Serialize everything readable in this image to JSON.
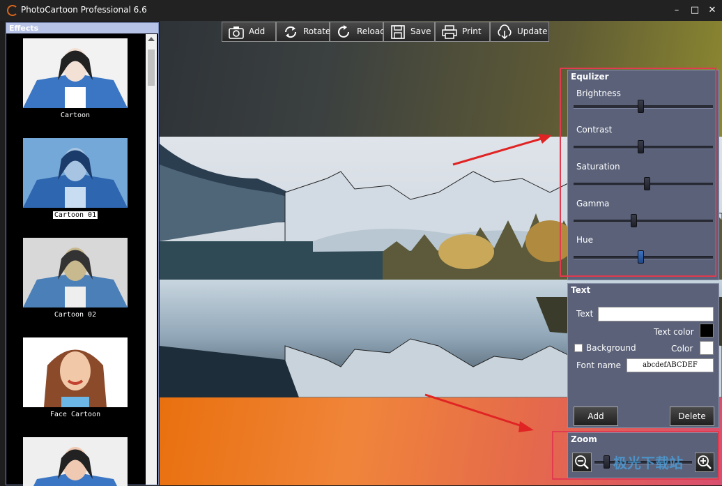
{
  "window": {
    "title": "PhotoCartoon Professional 6.6",
    "minimize": "–",
    "maximize": "□",
    "close": "✕"
  },
  "effects": {
    "header": "Effects",
    "items": [
      {
        "label": "Cartoon",
        "selected": false
      },
      {
        "label": "Cartoon 01",
        "selected": true
      },
      {
        "label": "Cartoon 02",
        "selected": false
      },
      {
        "label": "Face Cartoon",
        "selected": false
      },
      {
        "label": "",
        "selected": false
      }
    ]
  },
  "toolbar": {
    "add": "Add",
    "rotate": "Rotate",
    "reload": "Reload",
    "save": "Save",
    "print": "Print",
    "update": "Update"
  },
  "equalizer": {
    "header": "Equlizer",
    "sliders": [
      {
        "label": "Brightness",
        "value": 0.48
      },
      {
        "label": "Contrast",
        "value": 0.48
      },
      {
        "label": "Saturation",
        "value": 0.53
      },
      {
        "label": "Gamma",
        "value": 0.43
      },
      {
        "label": "Hue",
        "value": 0.48
      }
    ]
  },
  "text_panel": {
    "header": "Text",
    "text_label": "Text",
    "text_value": "",
    "text_color_label": "Text color",
    "text_color": "#000000",
    "background_label": "Background",
    "background_checked": false,
    "color_label": "Color",
    "color": "#ffffff",
    "font_name_label": "Font name",
    "font_sample": "abcdefABCDEF",
    "add_button": "Add",
    "delete_button": "Delete"
  },
  "zoom": {
    "header": "Zoom",
    "value": 0.1
  },
  "watermark": "极光下载站",
  "colors": {
    "accent_highlight": "#e23a4e",
    "panel_bg": "#5a6179",
    "effects_header": "#b7c3e6"
  }
}
